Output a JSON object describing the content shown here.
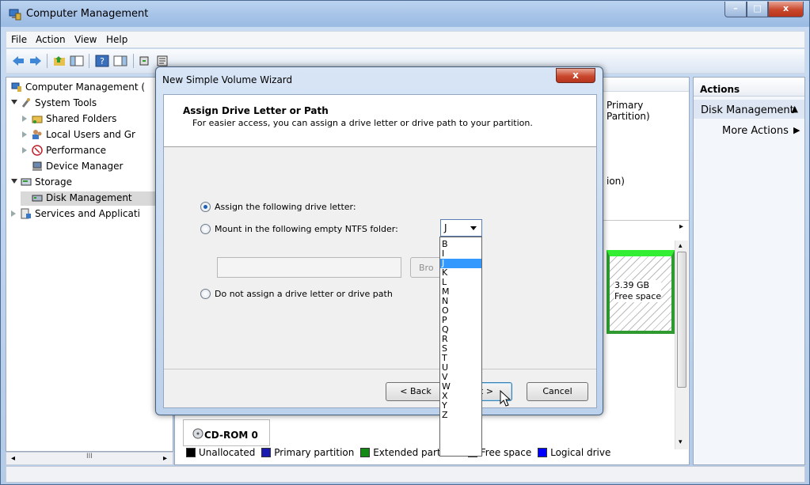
{
  "window": {
    "title": "Computer Management",
    "minimize": "–",
    "maximize": "□",
    "close": "x"
  },
  "menu": [
    "File",
    "Action",
    "View",
    "Help"
  ],
  "tree": {
    "root": "Computer Management (",
    "system_tools": "System Tools",
    "shared_folders": "Shared Folders",
    "local_users": "Local Users and Gr",
    "performance": "Performance",
    "device_manager": "Device Manager",
    "storage": "Storage",
    "disk_management": "Disk Management",
    "services": "Services and Applicati",
    "scroll_thumb": "III"
  },
  "center": {
    "partition_fragment": "Primary Partition)",
    "partition_fragment2": "ion)",
    "free_size": "3.39 GB",
    "free_label": "Free space",
    "cdrom": "CD-ROM 0",
    "legend": [
      {
        "label": "Unallocated",
        "color": "#000000"
      },
      {
        "label": "Primary partition",
        "color": "#1a1ab0"
      },
      {
        "label": "Extended partition",
        "color": "#138a13"
      },
      {
        "label": "Free space",
        "color": "#33ff33"
      },
      {
        "label": "Logical drive",
        "color": "#0000ff"
      }
    ]
  },
  "actions": {
    "header": "Actions",
    "section": "Disk Management",
    "more": "More Actions"
  },
  "wizard": {
    "title": "New Simple Volume Wizard",
    "close": "x",
    "heading": "Assign Drive Letter or Path",
    "subheading": "For easier access, you can assign a drive letter or drive path to your partition.",
    "opt_letter": "Assign the following drive letter:",
    "opt_folder": "Mount in the following empty NTFS folder:",
    "opt_none": "Do not assign a drive letter or drive path",
    "browse": "Bro",
    "back": "< Back",
    "next": "ext >",
    "cancel": "Cancel",
    "selected_letter": "J",
    "letters": [
      "B",
      "I",
      "J",
      "K",
      "L",
      "M",
      "N",
      "O",
      "P",
      "Q",
      "R",
      "S",
      "T",
      "U",
      "V",
      "W",
      "X",
      "Y",
      "Z"
    ],
    "highlighted_letter": "J"
  }
}
